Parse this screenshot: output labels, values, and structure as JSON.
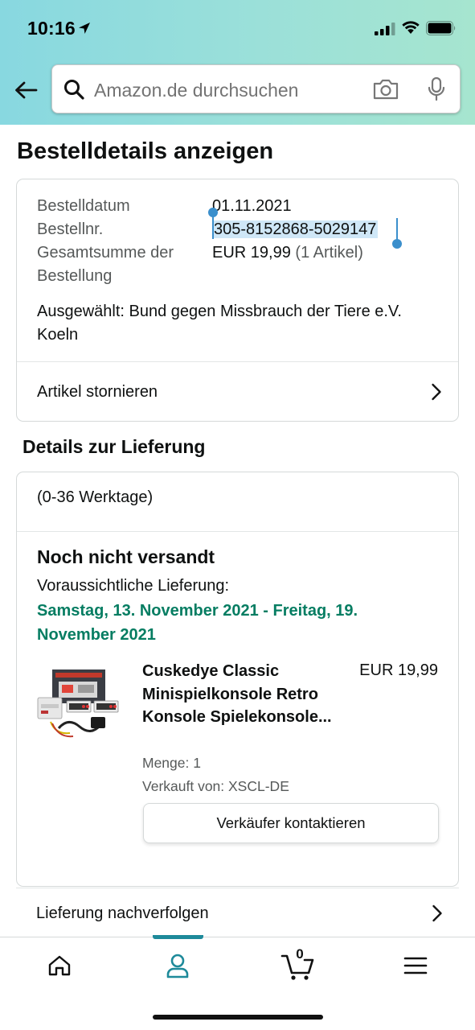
{
  "status_bar": {
    "time": "10:16"
  },
  "search": {
    "placeholder": "Amazon.de durchsuchen"
  },
  "page": {
    "title": "Bestelldetails anzeigen"
  },
  "order": {
    "date_label": "Bestelldatum",
    "date_value": "01.11.2021",
    "number_label": "Bestellnr.",
    "number_value": "305-8152868-5029147",
    "total_label": "Gesamtsumme der Bestellung",
    "total_value": "EUR 19,99",
    "total_items": "(1 Artikel)",
    "selected_charity": "Ausgewählt: Bund gegen Missbrauch der Tiere e.V. Koeln",
    "cancel_label": "Artikel stornieren"
  },
  "delivery": {
    "section_title": "Details zur Lieferung",
    "workdays": "(0-36 Werktage)",
    "status": "Noch nicht versandt",
    "expected_label": "Voraussichtliche Lieferung:",
    "expected_range": "Samstag, 13. November 2021 - Freitag, 19. November 2021",
    "product": {
      "title": "Cuskedye Classic Minispielkonsole Retro Konsole Spielekonsole...",
      "price": "EUR 19,99",
      "quantity": "Menge: 1",
      "seller": "Verkauft von: XSCL-DE",
      "contact_button": "Verkäufer kontaktieren"
    },
    "track_label": "Lieferung nachverfolgen"
  },
  "tabbar": {
    "active_tab": "account",
    "cart_count": "0",
    "tabs": [
      "home-icon",
      "account-icon",
      "cart-icon",
      "menu-icon"
    ]
  },
  "colors": {
    "header_gradient_start": "#88d8e0",
    "header_gradient_end": "#a6e5cf",
    "delivery_green": "#067d62",
    "tab_accent": "#1e8a9a",
    "selection_blue": "#3b8fcc"
  }
}
